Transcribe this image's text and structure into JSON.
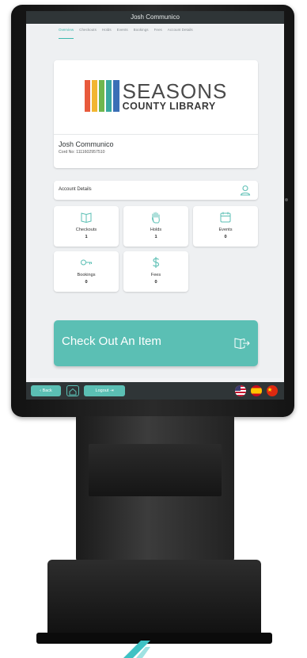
{
  "app": {
    "title": "Josh Communico"
  },
  "tabs": [
    {
      "label": "Overview",
      "active": true
    },
    {
      "label": "Checkouts"
    },
    {
      "label": "Holds"
    },
    {
      "label": "Events"
    },
    {
      "label": "Bookings"
    },
    {
      "label": "Fees"
    },
    {
      "label": "Account Details"
    }
  ],
  "library": {
    "name_line1": "SEASONS",
    "name_line2": "COUNTY LIBRARY",
    "stripe_colors": [
      "#e85a3c",
      "#f2b632",
      "#6fb74e",
      "#39a8a0",
      "#3b6fb6"
    ]
  },
  "patron": {
    "name": "Josh Communico",
    "card_number": "Cord No: 1111602957510"
  },
  "account": {
    "label": "Account Details",
    "icon": "user-icon"
  },
  "tiles": [
    {
      "label": "Checkouts",
      "value": "1",
      "icon": "book-icon"
    },
    {
      "label": "Holds",
      "value": "1",
      "icon": "hand-icon"
    },
    {
      "label": "Events",
      "value": "0",
      "icon": "calendar-icon"
    },
    {
      "label": "Bookings",
      "value": "0",
      "icon": "key-icon"
    },
    {
      "label": "Fees",
      "value": "0",
      "icon": "dollar-icon"
    }
  ],
  "checkout": {
    "label": "Check Out An Item",
    "icon": "checkout-book-icon"
  },
  "bottombar": {
    "back_label": "‹ Back",
    "logout_label": "Logout ⇥",
    "languages": [
      "English",
      "Spanish",
      "Chinese"
    ]
  },
  "colors": {
    "accent": "#5bbfb4",
    "bar": "#2f3537"
  }
}
